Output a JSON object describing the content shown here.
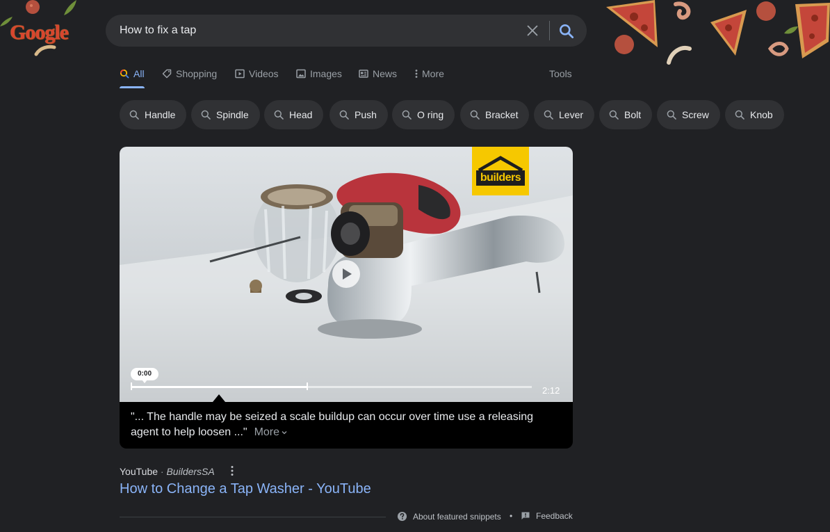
{
  "logo": {
    "text": "Google",
    "icon": "pizza-doodle-logo"
  },
  "search": {
    "query": "How to fix a tap",
    "clear_icon": "close-icon",
    "search_icon": "search-icon"
  },
  "tabs": [
    {
      "label": "All",
      "icon": "search-icon",
      "active": true
    },
    {
      "label": "Shopping",
      "icon": "tag-icon"
    },
    {
      "label": "Videos",
      "icon": "play-icon"
    },
    {
      "label": "Images",
      "icon": "image-icon"
    },
    {
      "label": "News",
      "icon": "news-icon"
    },
    {
      "label": "More",
      "icon": "more-vert-icon"
    }
  ],
  "tools_label": "Tools",
  "chips": [
    "Handle",
    "Spindle",
    "Head",
    "Push",
    "O ring",
    "Bracket",
    "Lever",
    "Bolt",
    "Screw",
    "Knob"
  ],
  "video": {
    "brand_logo": "builders",
    "current_time": "0:00",
    "duration": "2:12",
    "progress": 0.44,
    "caption": "\"... The handle may be seized a scale buildup can occur over time use a releasing agent to help loosen ...\"",
    "more_label": "More"
  },
  "result": {
    "source": "YouTube",
    "separator": " · ",
    "channel": "BuildersSA",
    "title": "How to Change a Tap Washer - YouTube"
  },
  "footer": {
    "about_label": "About featured snippets",
    "separator": "•",
    "feedback_label": "Feedback"
  },
  "colors": {
    "background": "#202124",
    "surface": "#303134",
    "link": "#8ab4f8",
    "text": "#e8eaed",
    "muted": "#9aa0a6",
    "brand_yellow": "#f6c800"
  }
}
